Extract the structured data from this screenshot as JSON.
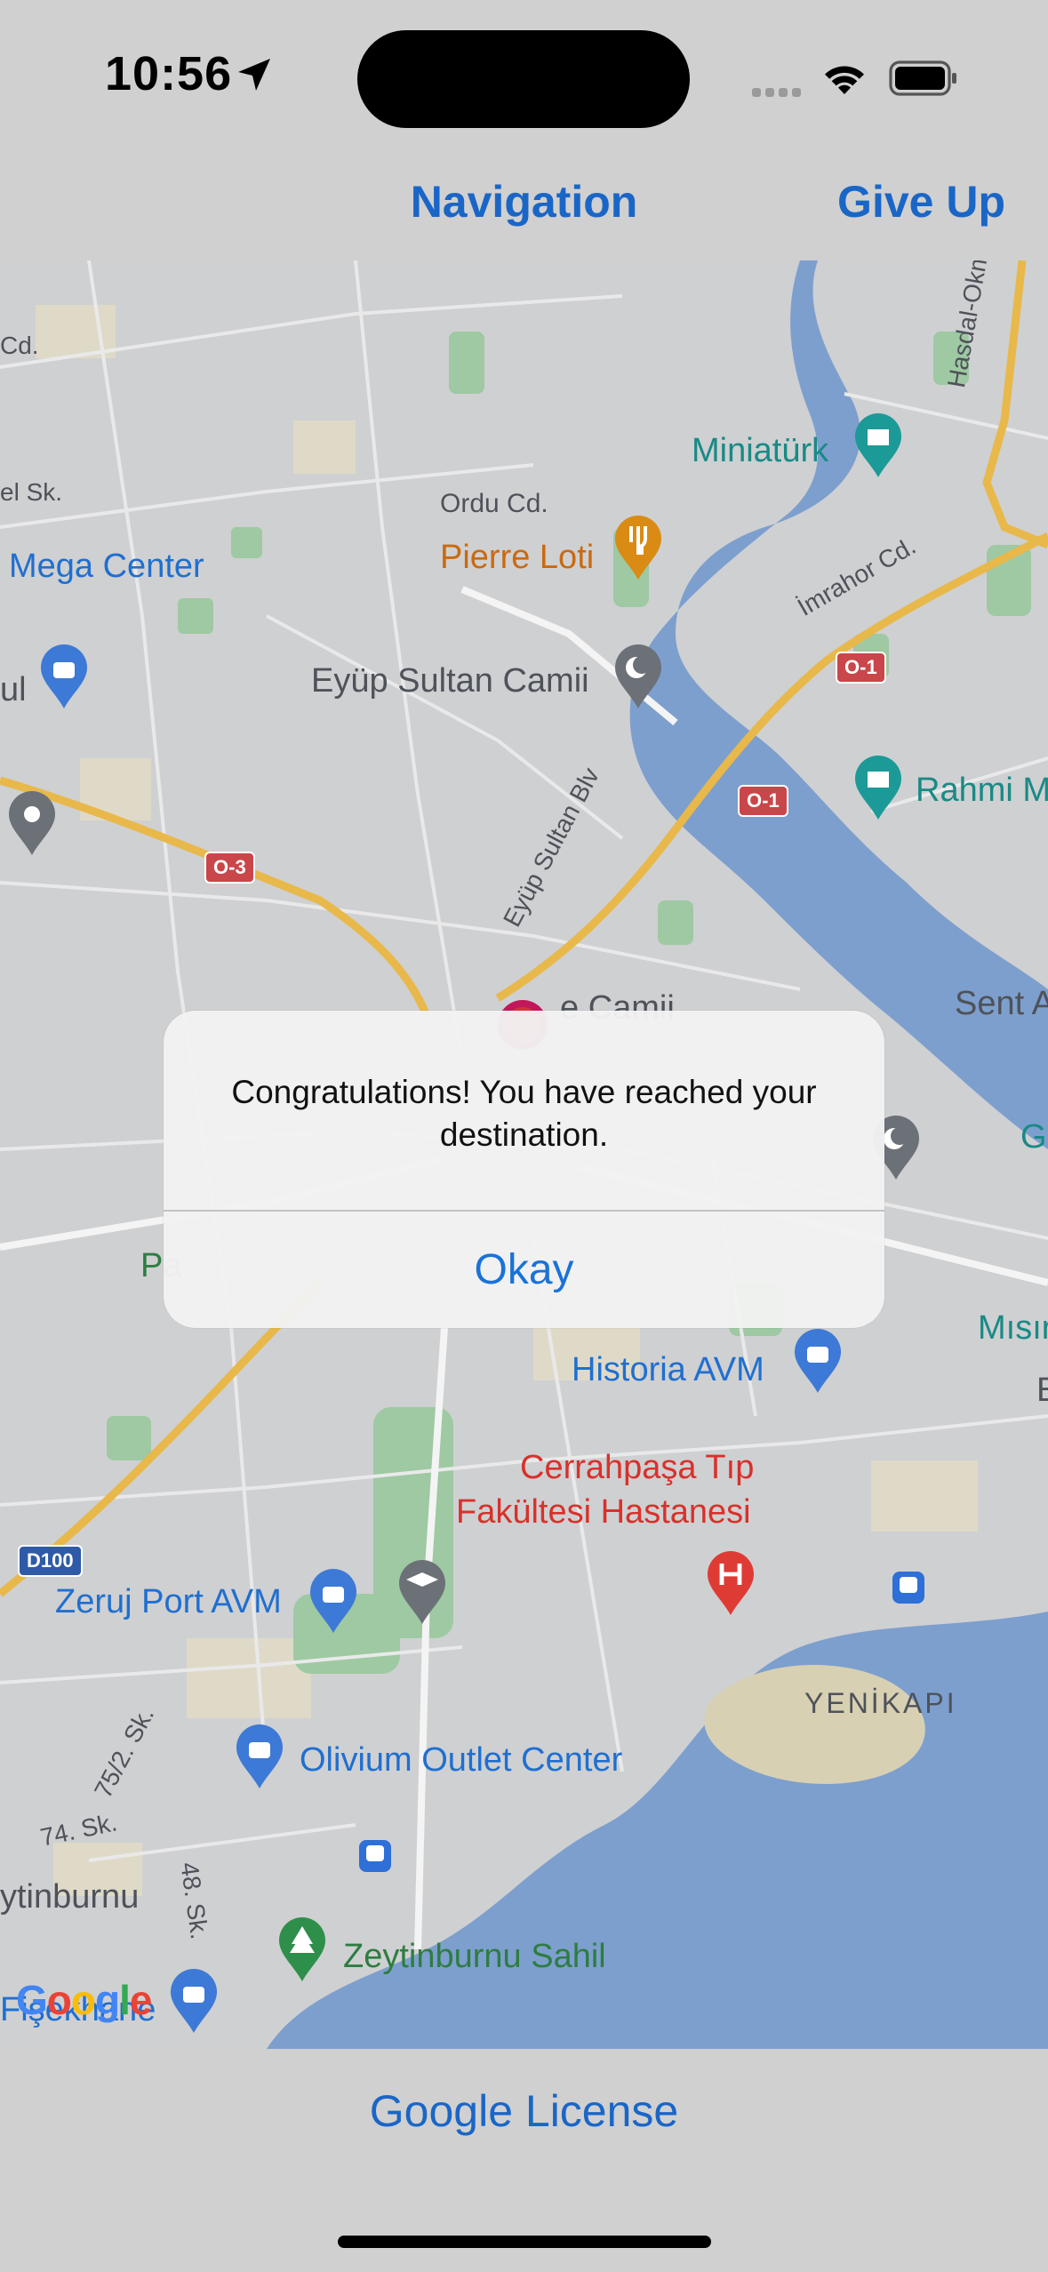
{
  "status_bar": {
    "time": "10:56"
  },
  "nav": {
    "title": "Navigation",
    "right_button": "Give Up"
  },
  "map": {
    "labels": {
      "mega_center": "Mega Center",
      "ordu_cd": "Ordu Cd.",
      "pierre_loti": "Pierre Loti",
      "miniaturk": "Miniatürk",
      "imrahor_cd": "İmrahor Cd.",
      "hasdal": "Hasdal-Okmeyda",
      "eyup_sultan_camii": "Eyüp Sultan Camii",
      "rahmi": "Rahmi M",
      "eyup_sultan_blv": "Eyüp Sultan Blv",
      "camii_partial": "e Camii",
      "sent_a": "Sent A",
      "historia": "Historia AVM",
      "misir": "Mısır",
      "cerrahpasa_line1": "Cerrahpaşa Tıp",
      "cerrahpasa_line2": "Fakültesi Hastanesi",
      "zeruj": "Zeruj Port AVM",
      "yenikapi": "YENİKAPI",
      "olivium": "Olivium Outlet Center",
      "sk_75": "75/2. Sk.",
      "sk_74": "74. Sk.",
      "sk_48": "48. Sk.",
      "zeytinburnu": "ytinburnu",
      "zeytinburnu_sahil": "Zeytinburnu Sahil",
      "fiskhane": "Fişekhane",
      "el_sk": "el Sk.",
      "cd_top": "Cd.",
      "ul": "ul",
      "pa": "Pa",
      "g_right": "G",
      "e_right": "E"
    },
    "shields": {
      "o3": "O-3",
      "o1_a": "O-1",
      "o1_b": "O-1",
      "d100": "D100"
    },
    "google": "Google"
  },
  "alert": {
    "message": "Congratulations! You have reached your destination.",
    "button": "Okay"
  },
  "footer": {
    "license": "Google License"
  },
  "colors": {
    "accent": "#1a66c7",
    "water": "#7d9fce",
    "park": "#9ec9a2",
    "highway": "#e8b84a"
  }
}
